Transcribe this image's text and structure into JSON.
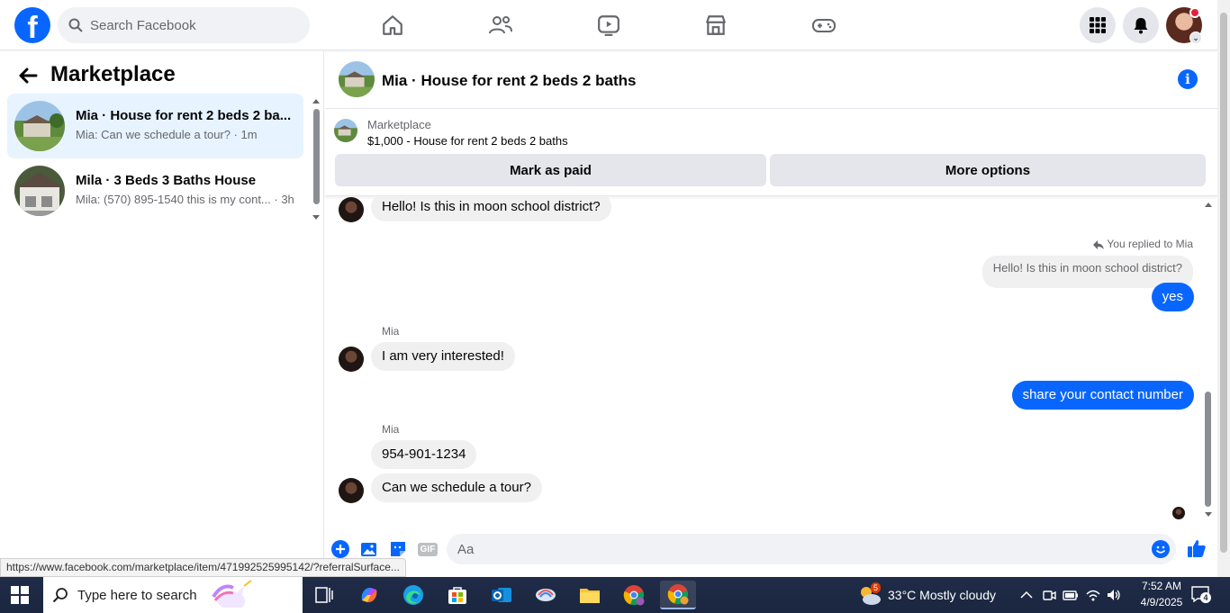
{
  "topnav": {
    "search_placeholder": "Search Facebook",
    "nav_icons": [
      "home-icon",
      "friends-icon",
      "watch-icon",
      "marketplace-icon",
      "gaming-icon"
    ],
    "right_icons": [
      "menu-grid-icon",
      "notifications-icon",
      "account-avatar"
    ]
  },
  "sidebar": {
    "title": "Marketplace",
    "conversations": [
      {
        "title": "Mia · House for rent 2 beds 2 ba...",
        "preview": "Mia: Can we schedule a tour? · 1m",
        "active": true
      },
      {
        "title": "Mila · 3 Beds 3 Baths House",
        "preview": "Mila: (570) 895-1540 this is my cont... · 3h",
        "active": false
      }
    ]
  },
  "chat": {
    "title": "Mia · House for rent 2 beds 2 baths",
    "listing": {
      "source": "Marketplace",
      "price_title": "$1,000 - House for rent 2 beds 2 baths",
      "mark_paid": "Mark as paid",
      "more_options": "More options"
    },
    "messages": {
      "m1": "Hello! Is this in moon school district?",
      "replied_label": "You replied to Mia",
      "quoted": "Hello! Is this in moon school district?",
      "m2": "yes",
      "sender1": "Mia",
      "m3": "I am very interested!",
      "m4": "share your contact number",
      "sender2": "Mia",
      "m5": "954-901-1234",
      "m6": "Can we schedule a tour?"
    },
    "composer": {
      "placeholder": "Aa",
      "gif_label": "GIF"
    }
  },
  "status_url": "https://www.facebook.com/marketplace/item/471992525995142/?referralSurface...",
  "taskbar": {
    "search_text": "Type here to search",
    "weather": "33°C  Mostly cloudy",
    "time": "7:52 AM",
    "date": "4/9/2025",
    "notification_count": "4",
    "weather_badge": "5"
  },
  "colors": {
    "brand_blue": "#0866ff",
    "bubble_in": "#f0f0f0",
    "active_conv": "#e7f3ff"
  }
}
